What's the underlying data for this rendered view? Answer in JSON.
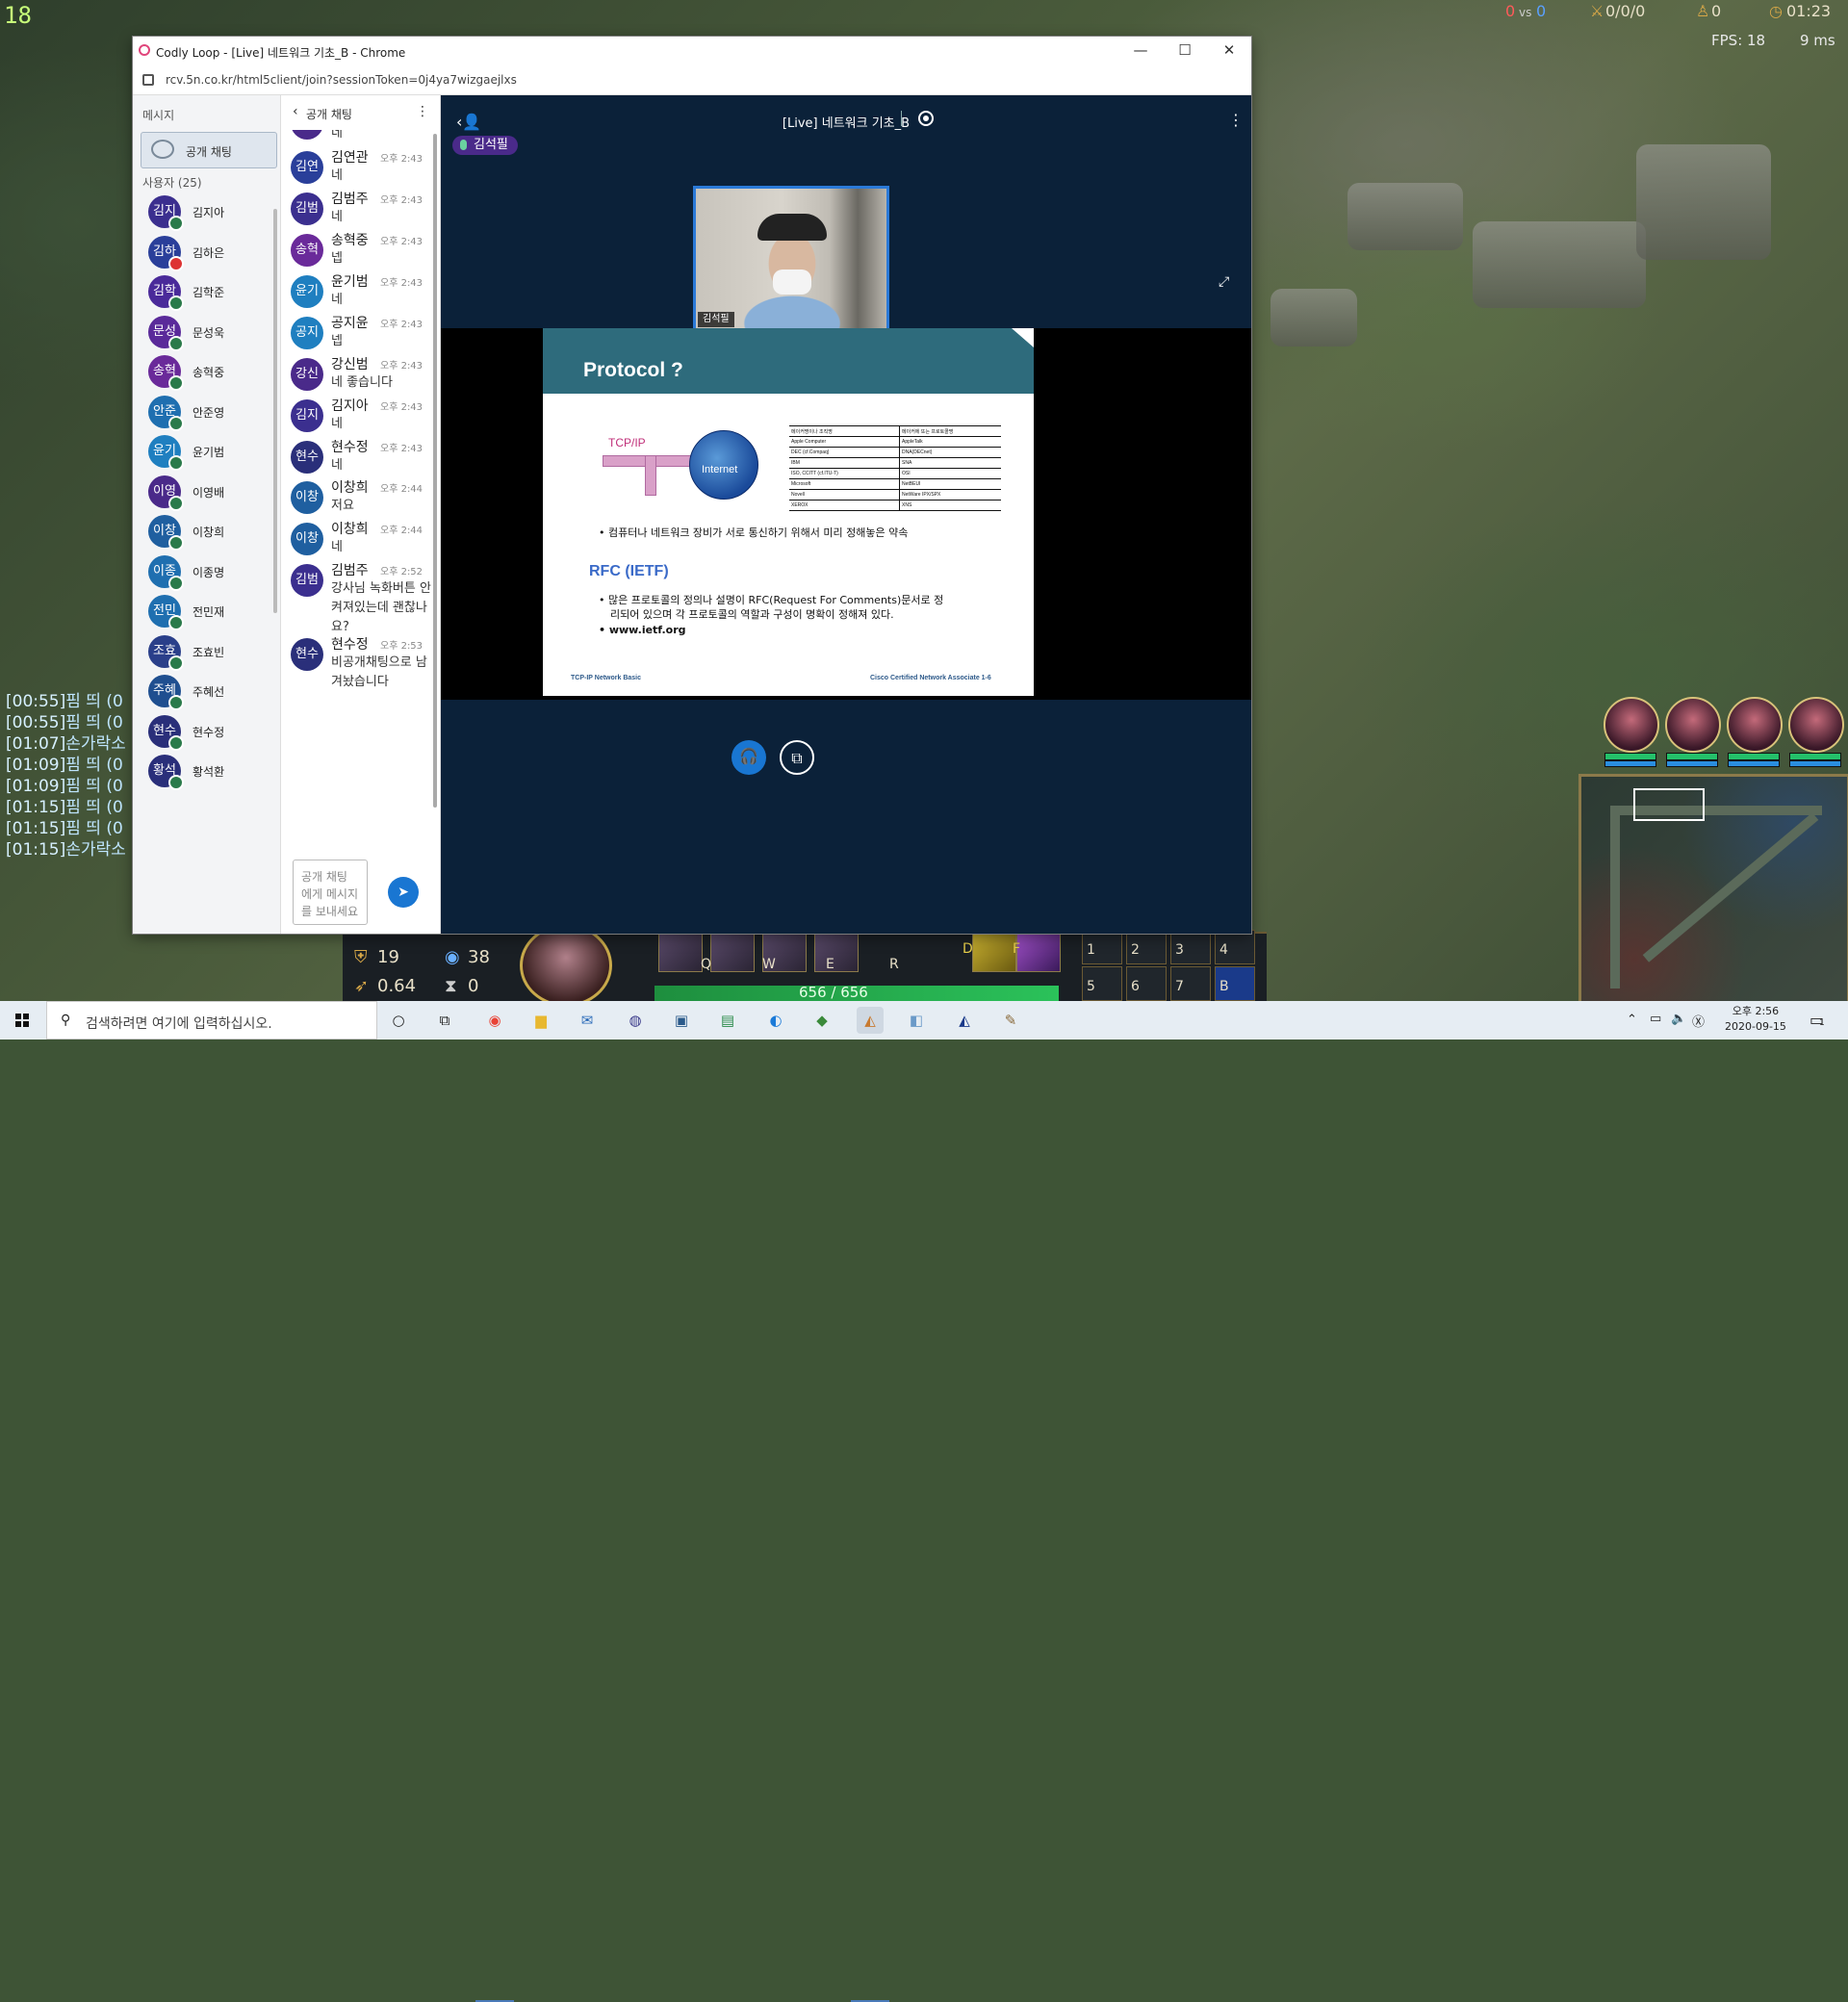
{
  "game": {
    "top_left_text": "18",
    "score_blue": "0",
    "score_vs": "vs",
    "score_red": "0",
    "kda": "0/0/0",
    "cs": "0",
    "timer": "01:23",
    "fps": "FPS: 18",
    "ping": "9 ms",
    "chat_log": [
      {
        "time": "[00:55]",
        "text": "핌 띄 (0"
      },
      {
        "time": "[00:55]",
        "text": "핌 띄 (0"
      },
      {
        "time": "[01:07]",
        "text": "손가락소"
      },
      {
        "time": "[01:09]",
        "text": "핌 띄 (0"
      },
      {
        "time": "[01:09]",
        "text": "핌 띄 (0"
      },
      {
        "time": "[01:15]",
        "text": "핌 띄 (0"
      },
      {
        "time": "[01:15]",
        "text": "핌 띄 (0"
      },
      {
        "time": "[01:15]",
        "text": "손가락소"
      }
    ],
    "stats": {
      "ad": "19",
      "ap": "38",
      "as": "0.64",
      "cdr": "0"
    },
    "hp": "656 / 656",
    "skill_keys": [
      "Q",
      "W",
      "E",
      "R",
      "D",
      "F"
    ],
    "item_keys": [
      "1",
      "2",
      "3",
      "4",
      "5",
      "6",
      "7",
      "B"
    ]
  },
  "browser": {
    "title": "Codly Loop - [Live] 네트워크 기초_B - Chrome",
    "url": "rcv.5n.co.kr/html5client/join?sessionToken=0j4ya7wizgaejlxs",
    "minimize": "—",
    "maximize": "☐",
    "close": "✕"
  },
  "left_panel": {
    "messages_header": "메시지",
    "public_chat": "공개 채팅",
    "users_header": "사용자 (25)",
    "users": [
      {
        "initials": "김지",
        "name": "김지아",
        "color": "#3b2f8f",
        "status": "green"
      },
      {
        "initials": "김하",
        "name": "김하은",
        "color": "#2a3f9a",
        "status": "red"
      },
      {
        "initials": "김학",
        "name": "김학준",
        "color": "#4a2a9a",
        "status": "green"
      },
      {
        "initials": "문성",
        "name": "문성욱",
        "color": "#5a2a9a",
        "status": "green"
      },
      {
        "initials": "송혁",
        "name": "송혁중",
        "color": "#6a2a9a",
        "status": "green"
      },
      {
        "initials": "안준",
        "name": "안준영",
        "color": "#1f6fb0",
        "status": "green"
      },
      {
        "initials": "윤기",
        "name": "윤기범",
        "color": "#1f7fc0",
        "status": "green"
      },
      {
        "initials": "이영",
        "name": "이영배",
        "color": "#4a2a8a",
        "status": "green"
      },
      {
        "initials": "이창",
        "name": "이창희",
        "color": "#1f5fa0",
        "status": "green"
      },
      {
        "initials": "이종",
        "name": "이종명",
        "color": "#1f6fb0",
        "status": "green"
      },
      {
        "initials": "전민",
        "name": "전민재",
        "color": "#1f6fb0",
        "status": "green"
      },
      {
        "initials": "조효",
        "name": "조효빈",
        "color": "#2a3f8a",
        "status": "green"
      },
      {
        "initials": "주혜",
        "name": "주혜선",
        "color": "#1f4f90",
        "status": "green"
      },
      {
        "initials": "현수",
        "name": "현수정",
        "color": "#2a2f7a",
        "status": "green"
      },
      {
        "initials": "황석",
        "name": "황석환",
        "color": "#2a2f7a",
        "status": "green"
      }
    ]
  },
  "chat": {
    "header": "공개 채팅",
    "back": "‹",
    "menu": "⋮",
    "partial_top": "네",
    "messages": [
      {
        "initials": "김연",
        "sender": "김연관",
        "time": "오후 2:43",
        "text": "네",
        "color": "#2a3f9a"
      },
      {
        "initials": "김범",
        "sender": "김범주",
        "time": "오후 2:43",
        "text": "네",
        "color": "#3b2f8f"
      },
      {
        "initials": "송혁",
        "sender": "송혁중",
        "time": "오후 2:43",
        "text": "넵",
        "color": "#6a2a9a"
      },
      {
        "initials": "윤기",
        "sender": "윤기범",
        "time": "오후 2:43",
        "text": "네",
        "color": "#1f7fc0"
      },
      {
        "initials": "공지",
        "sender": "공지윤",
        "time": "오후 2:43",
        "text": "넵",
        "color": "#1f7fc0"
      },
      {
        "initials": "강신",
        "sender": "강신범",
        "time": "오후 2:43",
        "text": "네 좋습니다",
        "color": "#4a2a8a"
      },
      {
        "initials": "김지",
        "sender": "김지아",
        "time": "오후 2:43",
        "text": "네",
        "color": "#3b2f8f"
      },
      {
        "initials": "현수",
        "sender": "현수정",
        "time": "오후 2:43",
        "text": "네",
        "color": "#2a2f7a"
      },
      {
        "initials": "이창",
        "sender": "이창희",
        "time": "오후 2:44",
        "text": "저요",
        "color": "#1f5fa0"
      },
      {
        "initials": "이창",
        "sender": "이창희",
        "time": "오후 2:44",
        "text": "네",
        "color": "#1f5fa0"
      },
      {
        "initials": "김범",
        "sender": "김범주",
        "time": "오후 2:52",
        "text": "강사님 녹화버튼 안켜져있는데 괜찮나요?",
        "color": "#3b2f8f"
      },
      {
        "initials": "현수",
        "sender": "현수정",
        "time": "오후 2:53",
        "text": "비공개채팅으로 남겨놨습니다",
        "color": "#2a2f7a"
      }
    ],
    "input_placeholder": "공개 채팅 에게 메시지를 보내세요",
    "send_icon": "➤"
  },
  "meeting": {
    "title": "[Live] 네트워크 기초_B",
    "speaker": "김석필",
    "webcam_name": "김석필",
    "fullscreen_icon": "⤢",
    "menu": "⋮",
    "user_icon": "‹👤",
    "audio_icon": "🎧",
    "video_icon": "⧉"
  },
  "slide": {
    "title": "Protocol ?",
    "tcpip_label": "TCP/IP",
    "internet_label": "Internet",
    "table_header": [
      "메이커명이나 조직명",
      "메이커에 또는 프로토콜명"
    ],
    "table_rows": [
      [
        "Apple Computer",
        "AppleTalk"
      ],
      [
        "DEC (cf.Compaq)",
        "DNA(DECnet)"
      ],
      [
        "IBM",
        "SNA"
      ],
      [
        "ISO, CCITT (cf.ITU-T)",
        "OSI"
      ],
      [
        "Microsoft",
        "NetBEUI"
      ],
      [
        "Novell",
        "NetWare IPX/SPX"
      ],
      [
        "XEROX",
        "XNS"
      ]
    ],
    "bullet1": "• 컴퓨터나 네트워크 장비가 서로 통신하기 위해서 미리 정해놓은 약속",
    "rfc_heading": "RFC (IETF)",
    "bullet2": "• 많은 프로토콜의 정의나 설명이 RFC(Request For Comments)문서로 정",
    "bullet2b": "리되어 있으며 각 프로토콜의 역할과 구성이 명확이 정해져 있다.",
    "bullet3": "• www.ietf.org",
    "footer_left": "TCP-IP Network Basic",
    "footer_right": "Cisco Certified Network Associate 1-6"
  },
  "taskbar": {
    "search_placeholder": "검색하려면 여기에 입력하십시오.",
    "time": "오후 2:56",
    "date": "2020-09-15",
    "notification_count": "1"
  }
}
